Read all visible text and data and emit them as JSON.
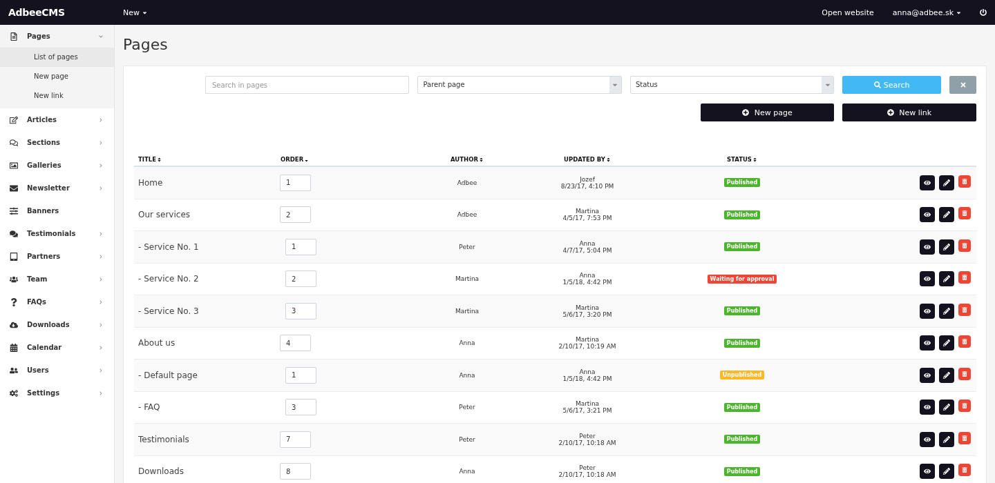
{
  "topbar": {
    "logo": "AdbeeCMS",
    "new_menu": "New",
    "open_website": "Open website",
    "user": "anna@adbee.sk"
  },
  "sidebar": {
    "items": [
      {
        "label": "Pages",
        "expanded": true,
        "children": [
          {
            "label": "List of pages",
            "selected": true
          },
          {
            "label": "New page",
            "selected": false
          },
          {
            "label": "New link",
            "selected": false
          }
        ]
      },
      {
        "label": "Articles",
        "expanded": false
      },
      {
        "label": "Sections",
        "expanded": false
      },
      {
        "label": "Galleries",
        "expanded": false
      },
      {
        "label": "Newsletter",
        "expanded": false
      },
      {
        "label": "Banners"
      },
      {
        "label": "Testimonials",
        "expanded": false
      },
      {
        "label": "Partners",
        "expanded": false
      },
      {
        "label": "Team",
        "expanded": false
      },
      {
        "label": "FAQs",
        "expanded": false
      },
      {
        "label": "Downloads",
        "expanded": false
      },
      {
        "label": "Calendar",
        "expanded": false
      },
      {
        "label": "Users",
        "expanded": false
      },
      {
        "label": "Settings",
        "expanded": false
      }
    ]
  },
  "page_title": "Pages",
  "filters": {
    "search": {
      "placeholder": "Search in pages"
    },
    "parent": {
      "value": "Parent page"
    },
    "status": {
      "value": "Status"
    },
    "search_button": "Search"
  },
  "actions": {
    "new_page": "New page",
    "new_link": "New link"
  },
  "table": {
    "columns": [
      {
        "label": "TITLE",
        "sorted": false
      },
      {
        "label": "ORDER",
        "sorted": true
      },
      {
        "label": "AUTHOR",
        "sorted": false
      },
      {
        "label": "UPDATED BY",
        "sorted": false
      },
      {
        "label": "STATUS",
        "sorted": false
      }
    ],
    "rows": [
      {
        "title": "Home",
        "order": "1",
        "author": "Adbee",
        "updated_by": "Jozef",
        "updated_at": "8/23/17, 4:10 PM",
        "status": "Published",
        "color": "#4cb52d"
      },
      {
        "title": "Our services",
        "order": "2",
        "author": "Adbee",
        "updated_by": "Martina",
        "updated_at": "4/5/17, 7:53 PM",
        "status": "Published",
        "color": "#4cb52d",
        "children": [
          {
            "title": "- Service No. 1",
            "order": "1",
            "author": "Peter",
            "updated_by": "Anna",
            "updated_at": "4/7/17, 5:04 PM",
            "status": "Published",
            "color": "#4cb52d"
          },
          {
            "title": "- Service No. 2",
            "order": "2",
            "author": "Martina",
            "updated_by": "Anna",
            "updated_at": "1/5/18, 4:42 PM",
            "status": "Waiting for approval",
            "color": "#ef4535"
          },
          {
            "title": "- Service No. 3",
            "order": "3",
            "author": "Martina",
            "updated_by": "Martina",
            "updated_at": "5/6/17, 3:20 PM",
            "status": "Published",
            "color": "#4cb52d"
          }
        ]
      },
      {
        "title": "About us",
        "order": "4",
        "author": "Anna",
        "updated_by": "Martina",
        "updated_at": "2/10/17, 10:19 AM",
        "status": "Published",
        "color": "#4cb52d",
        "children": [
          {
            "title": "- Default page",
            "order": "1",
            "author": "Anna",
            "updated_by": "Anna",
            "updated_at": "1/5/18, 4:42 PM",
            "status": "Unpublished",
            "color": "#fbb829"
          },
          {
            "title": "- FAQ",
            "order": "3",
            "author": "Peter",
            "updated_by": "Martina",
            "updated_at": "5/6/17, 3:21 PM",
            "status": "Published",
            "color": "#4cb52d"
          }
        ]
      },
      {
        "title": "Testimonials",
        "order": "7",
        "author": "Peter",
        "updated_by": "Peter",
        "updated_at": "2/10/17, 10:18 AM",
        "status": "Published",
        "color": "#4cb52d"
      },
      {
        "title": "Downloads",
        "order": "8",
        "author": "Anna",
        "updated_by": "Peter",
        "updated_at": "2/10/17, 10:18 AM",
        "status": "Published",
        "color": "#4cb52d"
      }
    ]
  }
}
